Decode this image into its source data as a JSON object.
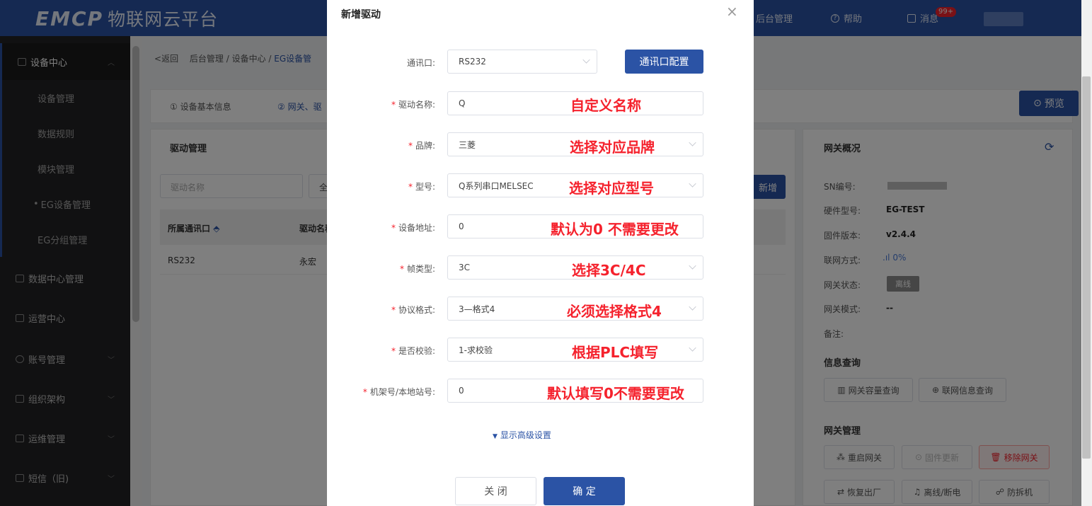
{
  "brand": {
    "logo": "EMCP",
    "name": "物联网云平台"
  },
  "topnav": {
    "backend": "后台管理",
    "help": "帮助",
    "messages": "消息",
    "badge": "99+"
  },
  "sidebar": {
    "groups": [
      {
        "label": "设备中心",
        "expanded": true
      },
      {
        "label": "数据中心管理"
      },
      {
        "label": "运营中心"
      },
      {
        "label": "账号管理"
      },
      {
        "label": "组织架构"
      },
      {
        "label": "运维管理"
      },
      {
        "label": "短信（旧)"
      }
    ],
    "sub": [
      "设备管理",
      "数据规则",
      "模块管理",
      "EG设备管理",
      "EG分组管理"
    ],
    "active_sub": "EG设备管理"
  },
  "breadcrumb": {
    "back": "返回",
    "items": [
      "后台管理",
      "设备中心",
      "EG设备管"
    ]
  },
  "steps": {
    "step1": "① 设备基本信息",
    "step2": "② 网关、驱"
  },
  "preview_btn": "预览",
  "driver_panel": {
    "title": "驱动管理",
    "search_placeholder": "驱动名称",
    "filter": "全",
    "add": "新增",
    "columns": [
      "所属通讯口",
      "驱动名称"
    ],
    "rows": [
      [
        "RS232",
        "永宏"
      ]
    ]
  },
  "gateway": {
    "title": "网关概况",
    "fields": [
      {
        "label": "SN编号:",
        "value": ""
      },
      {
        "label": "硬件型号:",
        "value": "EG-TEST"
      },
      {
        "label": "固件版本:",
        "value": "v2.4.4"
      },
      {
        "label": "联网方式:",
        "value": "0%"
      },
      {
        "label": "网关状态:",
        "value": "离线"
      },
      {
        "label": "网关模式:",
        "value": "--"
      },
      {
        "label": "备注:",
        "value": ""
      }
    ],
    "info_title": "信息查询",
    "info_buttons": [
      "网关容量查询",
      "联网信息查询"
    ],
    "manage_title": "网关管理",
    "manage_buttons": [
      "重启网关",
      "固件更新",
      "移除网关",
      "恢复出厂",
      "离线/断电",
      "防拆机"
    ]
  },
  "modal": {
    "title": "新增驱动",
    "port_config_btn": "通讯口配置",
    "fields": [
      {
        "label": "通讯口:",
        "required": false,
        "value": "RS232",
        "select": true,
        "note": ""
      },
      {
        "label": "驱动名称:",
        "required": true,
        "value": "Q",
        "select": false,
        "note": "自定义名称"
      },
      {
        "label": "品牌:",
        "required": true,
        "value": "三菱",
        "select": true,
        "note": "选择对应品牌"
      },
      {
        "label": "型号:",
        "required": true,
        "value": "Q系列串口MELSEC",
        "select": true,
        "note": "选择对应型号"
      },
      {
        "label": "设备地址:",
        "required": true,
        "value": "0",
        "select": false,
        "note": "默认为0 不需要更改"
      },
      {
        "label": "帧类型:",
        "required": true,
        "value": "3C",
        "select": true,
        "note": "选择3C/4C"
      },
      {
        "label": "协议格式:",
        "required": true,
        "value": "3—格式4",
        "select": true,
        "note": "必须选择格式4"
      },
      {
        "label": "是否校验:",
        "required": true,
        "value": "1-求校验",
        "select": true,
        "note": "根据PLC填写"
      },
      {
        "label": "机架号/本地站号:",
        "required": true,
        "value": "0",
        "select": false,
        "note": "默认填写0不需要更改"
      }
    ],
    "advanced": "显示高级设置",
    "close_btn": "关 闭",
    "confirm_btn": "确 定"
  }
}
